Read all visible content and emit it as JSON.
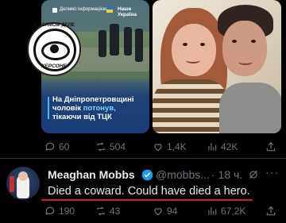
{
  "media": {
    "left_image": {
      "site_label": "Делимо інформацією",
      "brand_label": "Наше Україна",
      "caption_prefix": "На Дніпропетровщині чоловік ",
      "caption_highlight": "потонув,",
      "caption_suffix": " тікаючи від ТЦК"
    },
    "stamp": {
      "top_text": "НА САМОМ ДЕЛЕ",
      "bottom_text": "ХЕРСОНЕ"
    }
  },
  "quoted_actions": {
    "replies": "60",
    "reposts": "504",
    "likes": "1,4K",
    "views": "42K"
  },
  "reply": {
    "author_name": "Meaghan Mobbs",
    "handle": "@mobbs...",
    "time": "· 18 ч.",
    "more": "···",
    "text": "Died a coward. Could have died a hero.",
    "actions": {
      "replies": "190",
      "reposts": "43",
      "likes": "94",
      "views": "67,2K"
    }
  },
  "colors": {
    "background": "#000000",
    "text": "#e7e9ea",
    "muted": "#71767b",
    "verified": "#1d9bf0",
    "underline": "#c9201d"
  }
}
